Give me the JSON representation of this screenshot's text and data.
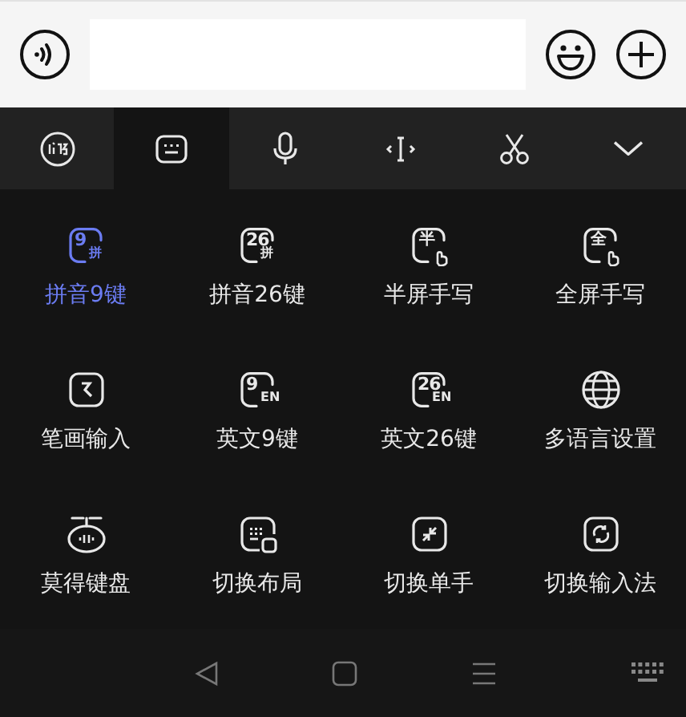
{
  "toolbar": [
    {
      "kind": "logo",
      "selected": false
    },
    {
      "kind": "keyboard",
      "selected": true
    },
    {
      "kind": "mic",
      "selected": false
    },
    {
      "kind": "cursor",
      "selected": false
    },
    {
      "kind": "scissors",
      "selected": false
    },
    {
      "kind": "collapse",
      "selected": false
    }
  ],
  "modes": [
    {
      "kind": "badge",
      "main": "9",
      "sub": "拼",
      "label": "拼音9键",
      "selected": true
    },
    {
      "kind": "badge",
      "main": "26",
      "sub": "拼",
      "label": "拼音26键",
      "selected": false
    },
    {
      "kind": "hand",
      "main": "半",
      "label": "半屏手写",
      "selected": false
    },
    {
      "kind": "hand",
      "main": "全",
      "label": "全屏手写",
      "selected": false
    },
    {
      "kind": "stroke",
      "label": "笔画输入",
      "selected": false
    },
    {
      "kind": "badge",
      "main": "9",
      "sub": "EN",
      "label": "英文9键",
      "selected": false
    },
    {
      "kind": "badge",
      "main": "26",
      "sub": "EN",
      "label": "英文26键",
      "selected": false
    },
    {
      "kind": "globe",
      "label": "多语言设置",
      "selected": false
    },
    {
      "kind": "voice",
      "label": "莫得键盘",
      "selected": false
    },
    {
      "kind": "layout",
      "label": "切换布局",
      "selected": false
    },
    {
      "kind": "shrink",
      "label": "切换单手",
      "selected": false
    },
    {
      "kind": "switch",
      "label": "切换输入法",
      "selected": false
    }
  ]
}
